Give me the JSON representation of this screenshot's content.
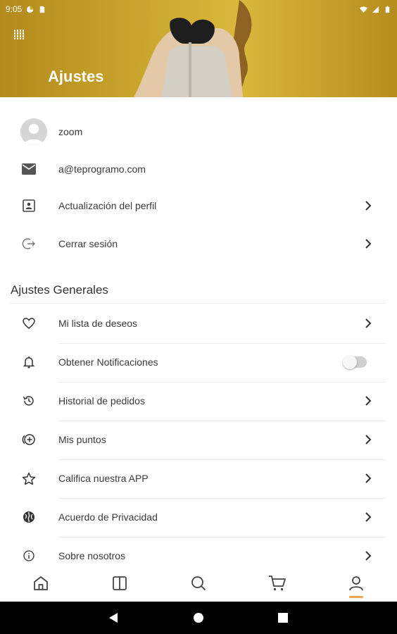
{
  "status_bar": {
    "time": "9:05",
    "icons": [
      "media-icon",
      "sim-card-icon",
      "wifi-icon",
      "signal-icon",
      "battery-icon"
    ]
  },
  "header": {
    "title": "Ajustes",
    "menu_icon": "grid-menu-icon",
    "background_color": "#c9a52e"
  },
  "profile": {
    "username": "zoom",
    "email": "a@teprogramo.com",
    "items": [
      {
        "label": "Actualización del perfil",
        "icon": "profile-card-icon"
      },
      {
        "label": "Cerrar sesión",
        "icon": "logout-icon"
      }
    ]
  },
  "general": {
    "title": "Ajustes Generales",
    "items": [
      {
        "label": "Mi lista de deseos",
        "icon": "heart-icon"
      },
      {
        "label": "Obtener Notificaciones",
        "icon": "bell-icon",
        "toggle": false
      },
      {
        "label": "Historial de pedidos",
        "icon": "history-icon"
      },
      {
        "label": "Mis puntos",
        "icon": "points-icon"
      },
      {
        "label": "Califica nuestra APP",
        "icon": "star-icon"
      },
      {
        "label": "Acuerdo de Privacidad",
        "icon": "privacy-icon"
      },
      {
        "label": "Sobre nosotros",
        "icon": "info-icon"
      }
    ]
  },
  "bottom_nav": {
    "items": [
      "home-icon",
      "catalog-icon",
      "search-icon",
      "cart-icon",
      "profile-icon"
    ],
    "active": "profile-icon",
    "accent_color": "#f0a65a"
  },
  "system_nav": [
    "back-icon",
    "home-circle-icon",
    "recents-icon"
  ]
}
